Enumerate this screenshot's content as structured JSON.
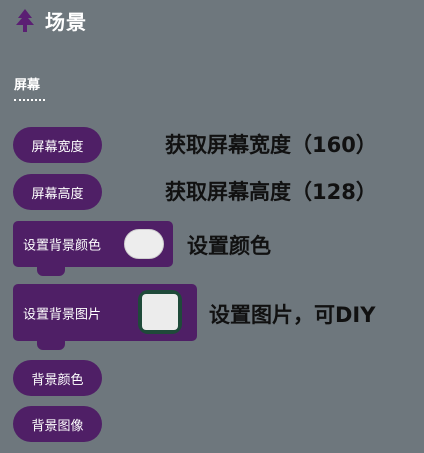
{
  "category": {
    "title": "场景",
    "icon": "tree-icon"
  },
  "section": {
    "label": "屏幕"
  },
  "blocks": [
    {
      "label": "屏幕宽度"
    },
    {
      "label": "屏幕高度"
    },
    {
      "label": "设置背景颜色"
    },
    {
      "label": "设置背景图片"
    },
    {
      "label": "背景颜色"
    },
    {
      "label": "背景图像"
    }
  ],
  "annotations": [
    "获取屏幕宽度（160）",
    "获取屏幕高度（128）",
    "设置颜色",
    "设置图片，可DIY"
  ],
  "colors": {
    "background": "#6e777d",
    "block": "#4f1f66",
    "image_slot": "#1f4a3a"
  }
}
